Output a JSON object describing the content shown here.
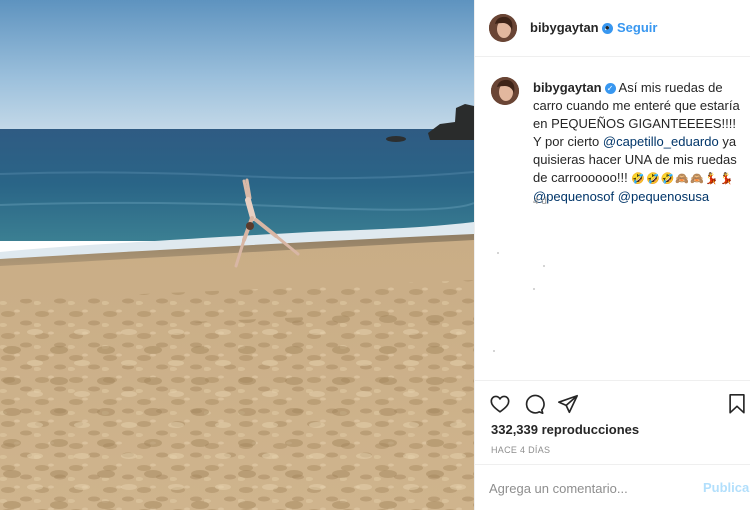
{
  "post": {
    "username": "bibygaytan",
    "verified_icon": "verified-badge-icon",
    "follow_label": "Seguir",
    "separator": "•"
  },
  "caption": {
    "username": "bibygaytan",
    "text_1": "Así mis ruedas de carro cuando me enteré que estaría en PEQUEÑOS GIGANTEEEES!!!! Y por cierto",
    "mention_1": "@capetillo_eduardo",
    "text_2": "ya quisieras hacer UNA de mis ruedas de carroooooo!!!",
    "emojis": "🤣🤣🤣🙈🙈💃💃",
    "mention_2": "@pequenosof",
    "mention_3": "@pequenosusa",
    "age": "4 d"
  },
  "actions": {
    "views": "332,339 reproducciones",
    "time": "HACE 4 DÍAS",
    "comment_placeholder": "Agrega un comentario...",
    "publish_label": "Publicar"
  },
  "colors": {
    "accent": "#3897f0",
    "publish_disabled": "#b2dffc",
    "mention": "#003569",
    "muted": "#8e8e8e"
  }
}
